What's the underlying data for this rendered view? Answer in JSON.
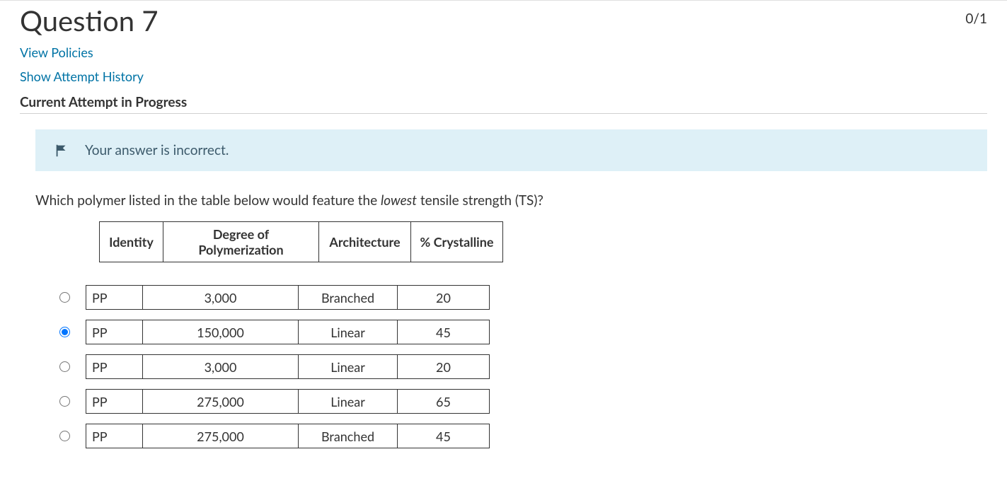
{
  "header": {
    "title": "Question 7",
    "score": "0/1"
  },
  "links": {
    "view_policies": "View Policies",
    "show_attempt_history": "Show Attempt History"
  },
  "current_attempt_label": "Current Attempt in Progress",
  "feedback": {
    "text": "Your answer is incorrect."
  },
  "prompt": {
    "pre": "Which polymer listed in the table below would feature the ",
    "emph": "lowest",
    "post": " tensile strength (TS)?"
  },
  "table_headers": {
    "identity": "Identity",
    "dp": "Degree of Polymerization",
    "architecture": "Architecture",
    "crystalline": "% Crystalline"
  },
  "options": [
    {
      "identity": "PP",
      "dp": "3,000",
      "architecture": "Branched",
      "crystalline": "20",
      "selected": false
    },
    {
      "identity": "PP",
      "dp": "150,000",
      "architecture": "Linear",
      "crystalline": "45",
      "selected": true
    },
    {
      "identity": "PP",
      "dp": "3,000",
      "architecture": "Linear",
      "crystalline": "20",
      "selected": false
    },
    {
      "identity": "PP",
      "dp": "275,000",
      "architecture": "Linear",
      "crystalline": "65",
      "selected": false
    },
    {
      "identity": "PP",
      "dp": "275,000",
      "architecture": "Branched",
      "crystalline": "45",
      "selected": false
    }
  ]
}
